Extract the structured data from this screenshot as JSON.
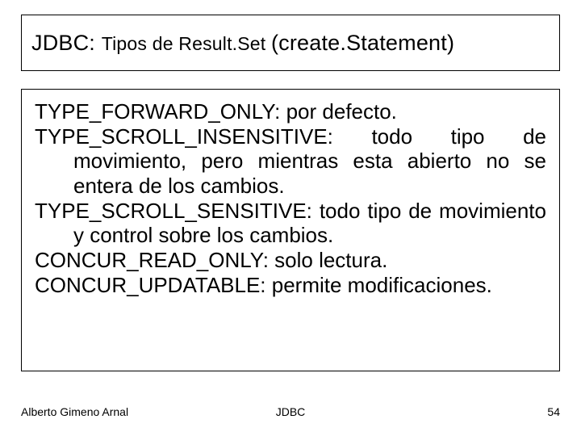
{
  "title": {
    "main": "JDBC: ",
    "sub": "Tipos de Result.Set ",
    "paren": "(create.Statement)"
  },
  "body": {
    "p1": "TYPE_FORWARD_ONLY: por defecto.",
    "p2": "TYPE_SCROLL_INSENSITIVE: todo tipo de movimiento, pero mientras esta abierto no se entera de los cambios.",
    "p3": "TYPE_SCROLL_SENSITIVE: todo tipo de movimiento y control sobre los cambios.",
    "p4": "CONCUR_READ_ONLY: solo lectura.",
    "p5": "CONCUR_UPDATABLE: permite modificaciones."
  },
  "footer": {
    "author": "Alberto Gimeno Arnal",
    "topic": "JDBC",
    "page": "54"
  }
}
